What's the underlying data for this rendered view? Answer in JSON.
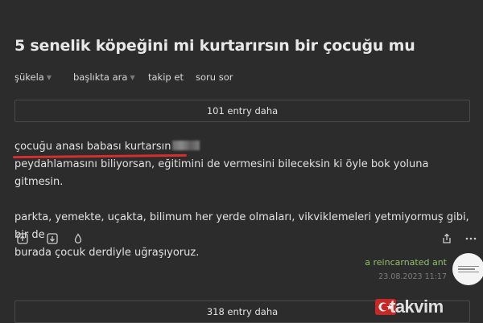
{
  "topic": {
    "title": "5 senelik köpeğini mi kurtarırsın bir çocuğu mu"
  },
  "nav": {
    "sukela": "şükela",
    "baslikta_ara": "başlıkta ara",
    "takip_et": "takip et",
    "soru_sor": "soru sor"
  },
  "more_top": "101 entry daha",
  "entry": {
    "line1": "çocuğu anası babası kurtarsın",
    "line2": "peydahlamasını biliyorsan, eğitimini de vermesini bileceksin ki öyle bok yoluna gitmesin.",
    "para2_line1": "parkta, yemekte, uçakta, bilimum her yerde olmaları, vikviklemeleri yetmiyormuş gibi, bir de",
    "para2_line2": "burada çocuk derdiyle uğraşıyoruz.",
    "author": "a reincarnated ant",
    "date": "23.08.2023 11:17"
  },
  "more_bottom": "318 entry daha",
  "watermark": "takvim",
  "colors": {
    "background": "#2c2c2c",
    "author": "#8fbf6a",
    "underline_annotation": "#d32f2f"
  },
  "icons": [
    "upvote-icon",
    "downvote-icon",
    "drop-icon",
    "share-icon",
    "more-icon"
  ]
}
